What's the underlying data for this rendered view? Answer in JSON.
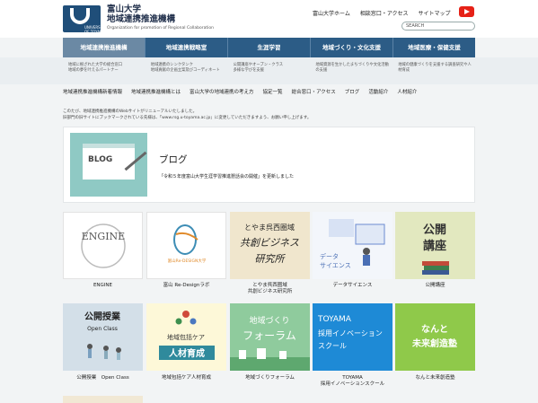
{
  "header": {
    "univ_name": "富山大学",
    "org_name": "地域連携推進機構",
    "org_english": "Organization for promotion of Regional Collaboration",
    "toplinks": [
      "富山大学ホーム",
      "相談窓口・アクセス",
      "サイトマップ"
    ],
    "search_placeholder": "SEARCH"
  },
  "nav": {
    "items": [
      {
        "label": "地域連携推進機構",
        "desc": "地域に根ざれた大学の総合窓口\n地域の夢を叶えるパートナー"
      },
      {
        "label": "地域連携戦略室",
        "desc": "地域連携のシンクタンク\n地域貢献の企画立案及びコーディネート"
      },
      {
        "label": "生涯学習",
        "desc": "公開講座やオープン・クラス\n多様な学びを支援"
      },
      {
        "label": "地域づくり・文化支援",
        "desc": "地域資源を生かしたまちづくりや文化活動の支援"
      },
      {
        "label": "地域医療・保健支援",
        "desc": "地域の健康づくりを支援する調査研究や人材育成"
      }
    ]
  },
  "subnav": {
    "items": [
      "地域連携推進機構新着情報",
      "地域連携推進機構とは",
      "富山大学の地域連携の考え方",
      "協定一覧",
      "総合窓口・アクセス",
      "ブログ",
      "活動紹介",
      "人材紹介"
    ]
  },
  "notice": {
    "line1": "このたび、地域連携推進機構のWebサイトがリニューアルいたしました。",
    "line2": "旧部門の旧サイトにブックマークされている先様は、「www.rsg.u-toyama.ac.jp」に変更していただきますよう、お願い申し上げます。"
  },
  "blog": {
    "thumb_text": "BLOG",
    "title": "ブログ",
    "text": "「令和５年度富山大学生涯学習推進懇話会の開催」を更新しました"
  },
  "tiles": [
    {
      "label": "ENGINE",
      "img_text": "ENGINE"
    },
    {
      "label": "富山 Re-Designラボ",
      "img_text": "富山Re-DESIGN大学"
    },
    {
      "label": "とやま呉西圏域\n共創ビジネス研究所",
      "img_text": "とやま呉西圏域\n共創ビジネス\n研究所"
    },
    {
      "label": "データサイエンス",
      "img_text": "データ\nサイエンス"
    },
    {
      "label": "公開講座",
      "img_text": "公開\n講座"
    },
    {
      "label": "公開授業　Open Class",
      "img_text": "公開授業\nOpen Class"
    },
    {
      "label": "地域包括ケア人材育成",
      "img_text": "地域包括ケア\n人材育成"
    },
    {
      "label": "地域づくりフォーラム",
      "img_text": "地域づくり\nフォーラム"
    },
    {
      "label": "TOYAMA\n採用イノベーションスクール",
      "img_text": "TOYAMA\n採用イノベーション\nスクール"
    },
    {
      "label": "なんと未来創造塾",
      "img_text": "なんと\n未来創造塾"
    }
  ],
  "colors": {
    "nav_bg": "#2c5c86",
    "nav_active": "#6b89a4",
    "brand": "#1f4e79"
  }
}
